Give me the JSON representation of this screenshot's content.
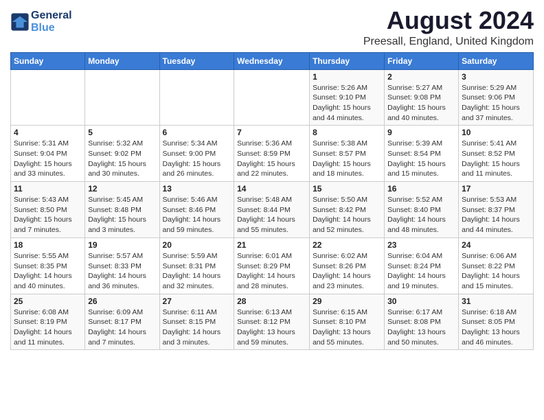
{
  "header": {
    "logo_line1": "General",
    "logo_line2": "Blue",
    "title": "August 2024",
    "subtitle": "Preesall, England, United Kingdom"
  },
  "calendar": {
    "days_of_week": [
      "Sunday",
      "Monday",
      "Tuesday",
      "Wednesday",
      "Thursday",
      "Friday",
      "Saturday"
    ],
    "weeks": [
      [
        {
          "day": "",
          "info": ""
        },
        {
          "day": "",
          "info": ""
        },
        {
          "day": "",
          "info": ""
        },
        {
          "day": "",
          "info": ""
        },
        {
          "day": "1",
          "info": "Sunrise: 5:26 AM\nSunset: 9:10 PM\nDaylight: 15 hours\nand 44 minutes."
        },
        {
          "day": "2",
          "info": "Sunrise: 5:27 AM\nSunset: 9:08 PM\nDaylight: 15 hours\nand 40 minutes."
        },
        {
          "day": "3",
          "info": "Sunrise: 5:29 AM\nSunset: 9:06 PM\nDaylight: 15 hours\nand 37 minutes."
        }
      ],
      [
        {
          "day": "4",
          "info": "Sunrise: 5:31 AM\nSunset: 9:04 PM\nDaylight: 15 hours\nand 33 minutes."
        },
        {
          "day": "5",
          "info": "Sunrise: 5:32 AM\nSunset: 9:02 PM\nDaylight: 15 hours\nand 30 minutes."
        },
        {
          "day": "6",
          "info": "Sunrise: 5:34 AM\nSunset: 9:00 PM\nDaylight: 15 hours\nand 26 minutes."
        },
        {
          "day": "7",
          "info": "Sunrise: 5:36 AM\nSunset: 8:59 PM\nDaylight: 15 hours\nand 22 minutes."
        },
        {
          "day": "8",
          "info": "Sunrise: 5:38 AM\nSunset: 8:57 PM\nDaylight: 15 hours\nand 18 minutes."
        },
        {
          "day": "9",
          "info": "Sunrise: 5:39 AM\nSunset: 8:54 PM\nDaylight: 15 hours\nand 15 minutes."
        },
        {
          "day": "10",
          "info": "Sunrise: 5:41 AM\nSunset: 8:52 PM\nDaylight: 15 hours\nand 11 minutes."
        }
      ],
      [
        {
          "day": "11",
          "info": "Sunrise: 5:43 AM\nSunset: 8:50 PM\nDaylight: 15 hours\nand 7 minutes."
        },
        {
          "day": "12",
          "info": "Sunrise: 5:45 AM\nSunset: 8:48 PM\nDaylight: 15 hours\nand 3 minutes."
        },
        {
          "day": "13",
          "info": "Sunrise: 5:46 AM\nSunset: 8:46 PM\nDaylight: 14 hours\nand 59 minutes."
        },
        {
          "day": "14",
          "info": "Sunrise: 5:48 AM\nSunset: 8:44 PM\nDaylight: 14 hours\nand 55 minutes."
        },
        {
          "day": "15",
          "info": "Sunrise: 5:50 AM\nSunset: 8:42 PM\nDaylight: 14 hours\nand 52 minutes."
        },
        {
          "day": "16",
          "info": "Sunrise: 5:52 AM\nSunset: 8:40 PM\nDaylight: 14 hours\nand 48 minutes."
        },
        {
          "day": "17",
          "info": "Sunrise: 5:53 AM\nSunset: 8:37 PM\nDaylight: 14 hours\nand 44 minutes."
        }
      ],
      [
        {
          "day": "18",
          "info": "Sunrise: 5:55 AM\nSunset: 8:35 PM\nDaylight: 14 hours\nand 40 minutes."
        },
        {
          "day": "19",
          "info": "Sunrise: 5:57 AM\nSunset: 8:33 PM\nDaylight: 14 hours\nand 36 minutes."
        },
        {
          "day": "20",
          "info": "Sunrise: 5:59 AM\nSunset: 8:31 PM\nDaylight: 14 hours\nand 32 minutes."
        },
        {
          "day": "21",
          "info": "Sunrise: 6:01 AM\nSunset: 8:29 PM\nDaylight: 14 hours\nand 28 minutes."
        },
        {
          "day": "22",
          "info": "Sunrise: 6:02 AM\nSunset: 8:26 PM\nDaylight: 14 hours\nand 23 minutes."
        },
        {
          "day": "23",
          "info": "Sunrise: 6:04 AM\nSunset: 8:24 PM\nDaylight: 14 hours\nand 19 minutes."
        },
        {
          "day": "24",
          "info": "Sunrise: 6:06 AM\nSunset: 8:22 PM\nDaylight: 14 hours\nand 15 minutes."
        }
      ],
      [
        {
          "day": "25",
          "info": "Sunrise: 6:08 AM\nSunset: 8:19 PM\nDaylight: 14 hours\nand 11 minutes."
        },
        {
          "day": "26",
          "info": "Sunrise: 6:09 AM\nSunset: 8:17 PM\nDaylight: 14 hours\nand 7 minutes."
        },
        {
          "day": "27",
          "info": "Sunrise: 6:11 AM\nSunset: 8:15 PM\nDaylight: 14 hours\nand 3 minutes."
        },
        {
          "day": "28",
          "info": "Sunrise: 6:13 AM\nSunset: 8:12 PM\nDaylight: 13 hours\nand 59 minutes."
        },
        {
          "day": "29",
          "info": "Sunrise: 6:15 AM\nSunset: 8:10 PM\nDaylight: 13 hours\nand 55 minutes."
        },
        {
          "day": "30",
          "info": "Sunrise: 6:17 AM\nSunset: 8:08 PM\nDaylight: 13 hours\nand 50 minutes."
        },
        {
          "day": "31",
          "info": "Sunrise: 6:18 AM\nSunset: 8:05 PM\nDaylight: 13 hours\nand 46 minutes."
        }
      ]
    ]
  }
}
